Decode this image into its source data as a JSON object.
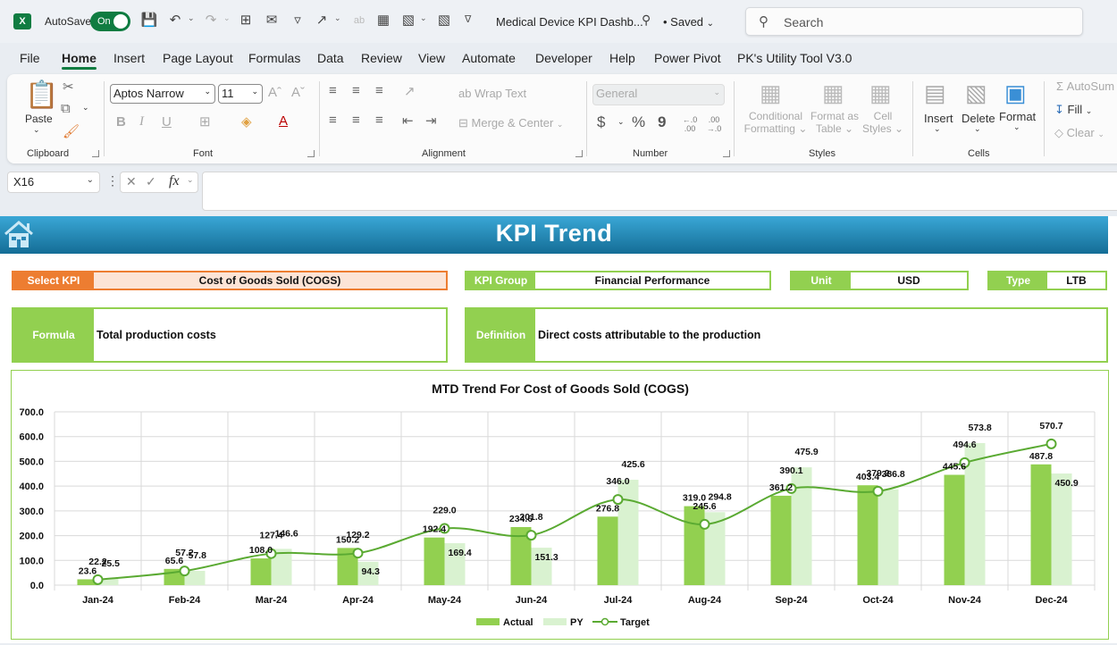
{
  "titlebar": {
    "app_icon": "excel-icon",
    "autosave_label": "AutoSave",
    "autosave_state": "On",
    "doc_title": "Medical Device KPI Dashb...",
    "saved_status": "• Saved",
    "search_placeholder": "Search"
  },
  "tabs": [
    "File",
    "Home",
    "Insert",
    "Page Layout",
    "Formulas",
    "Data",
    "Review",
    "View",
    "Automate",
    "Developer",
    "Help",
    "Power Pivot",
    "PK's Utility Tool V3.0"
  ],
  "active_tab": "Home",
  "ribbon": {
    "clipboard": {
      "paste": "Paste",
      "label": "Clipboard"
    },
    "font": {
      "name": "Aptos Narrow",
      "size": "11",
      "label": "Font",
      "bold": "B",
      "italic": "I",
      "underline": "U"
    },
    "alignment": {
      "wrap_text": "Wrap Text",
      "merge_center": "Merge & Center",
      "label": "Alignment"
    },
    "number": {
      "format": "General",
      "currency": "$",
      "percent": "%",
      "comma": "9",
      "inc_decimal": "←.0 .00",
      "dec_decimal": ".00 →.0",
      "label": "Number"
    },
    "styles": {
      "conditional": "Conditional",
      "conditional2": "Formatting",
      "format_as": "Format as",
      "format_as2": "Table",
      "cell": "Cell",
      "cell2": "Styles",
      "label": "Styles"
    },
    "cells": {
      "insert": "Insert",
      "delete": "Delete",
      "format": "Format",
      "label": "Cells"
    },
    "editing": {
      "autosum": "AutoSum",
      "fill": "Fill",
      "clear": "Clear"
    }
  },
  "formula_bar": {
    "name_box": "X16",
    "fx": "fx",
    "value": ""
  },
  "dashboard": {
    "title": "KPI Trend",
    "select_kpi_label": "Select KPI",
    "select_kpi_value": "Cost of Goods Sold (COGS)",
    "kpi_group_label": "KPI Group",
    "kpi_group_value": "Financial Performance",
    "unit_label": "Unit",
    "unit_value": "USD",
    "type_label": "Type",
    "type_value": "LTB",
    "formula_label": "Formula",
    "formula_value": "Total production costs",
    "definition_label": "Definition",
    "definition_value": "Direct costs attributable to the production"
  },
  "colors": {
    "accent_orange": "#ed7d31",
    "accent_green": "#92d050",
    "actual_bar": "#92d050",
    "py_bar": "#d9f2d0",
    "target_line": "#5aaa32",
    "banner_top": "#3aa7d6",
    "banner_bottom": "#146d96"
  },
  "chart_data": {
    "type": "bar",
    "title": "MTD Trend For Cost of Goods Sold (COGS)",
    "xlabel": "",
    "ylabel": "",
    "ylim": [
      0,
      700
    ],
    "yticks": [
      "0.0",
      "100.0",
      "200.0",
      "300.0",
      "400.0",
      "500.0",
      "600.0",
      "700.0"
    ],
    "grid": true,
    "legend_position": "bottom",
    "categories": [
      "Jan-24",
      "Feb-24",
      "Mar-24",
      "Apr-24",
      "May-24",
      "Jun-24",
      "Jul-24",
      "Aug-24",
      "Sep-24",
      "Oct-24",
      "Nov-24",
      "Dec-24"
    ],
    "series": [
      {
        "name": "Actual",
        "kind": "bar",
        "values": [
          23.6,
          65.6,
          108.0,
          150.2,
          192.4,
          234.6,
          276.8,
          319.0,
          361.2,
          403.4,
          445.6,
          487.8
        ]
      },
      {
        "name": "PY",
        "kind": "bar",
        "values": [
          25.5,
          57.8,
          146.6,
          94.3,
          169.4,
          151.3,
          425.6,
          294.8,
          475.9,
          386.8,
          573.8,
          450.9
        ]
      },
      {
        "name": "Target",
        "kind": "line",
        "values": [
          22.2,
          57.2,
          127.4,
          129.2,
          229.0,
          201.8,
          346.0,
          245.6,
          390.1,
          379.2,
          494.6,
          570.7
        ]
      }
    ]
  }
}
